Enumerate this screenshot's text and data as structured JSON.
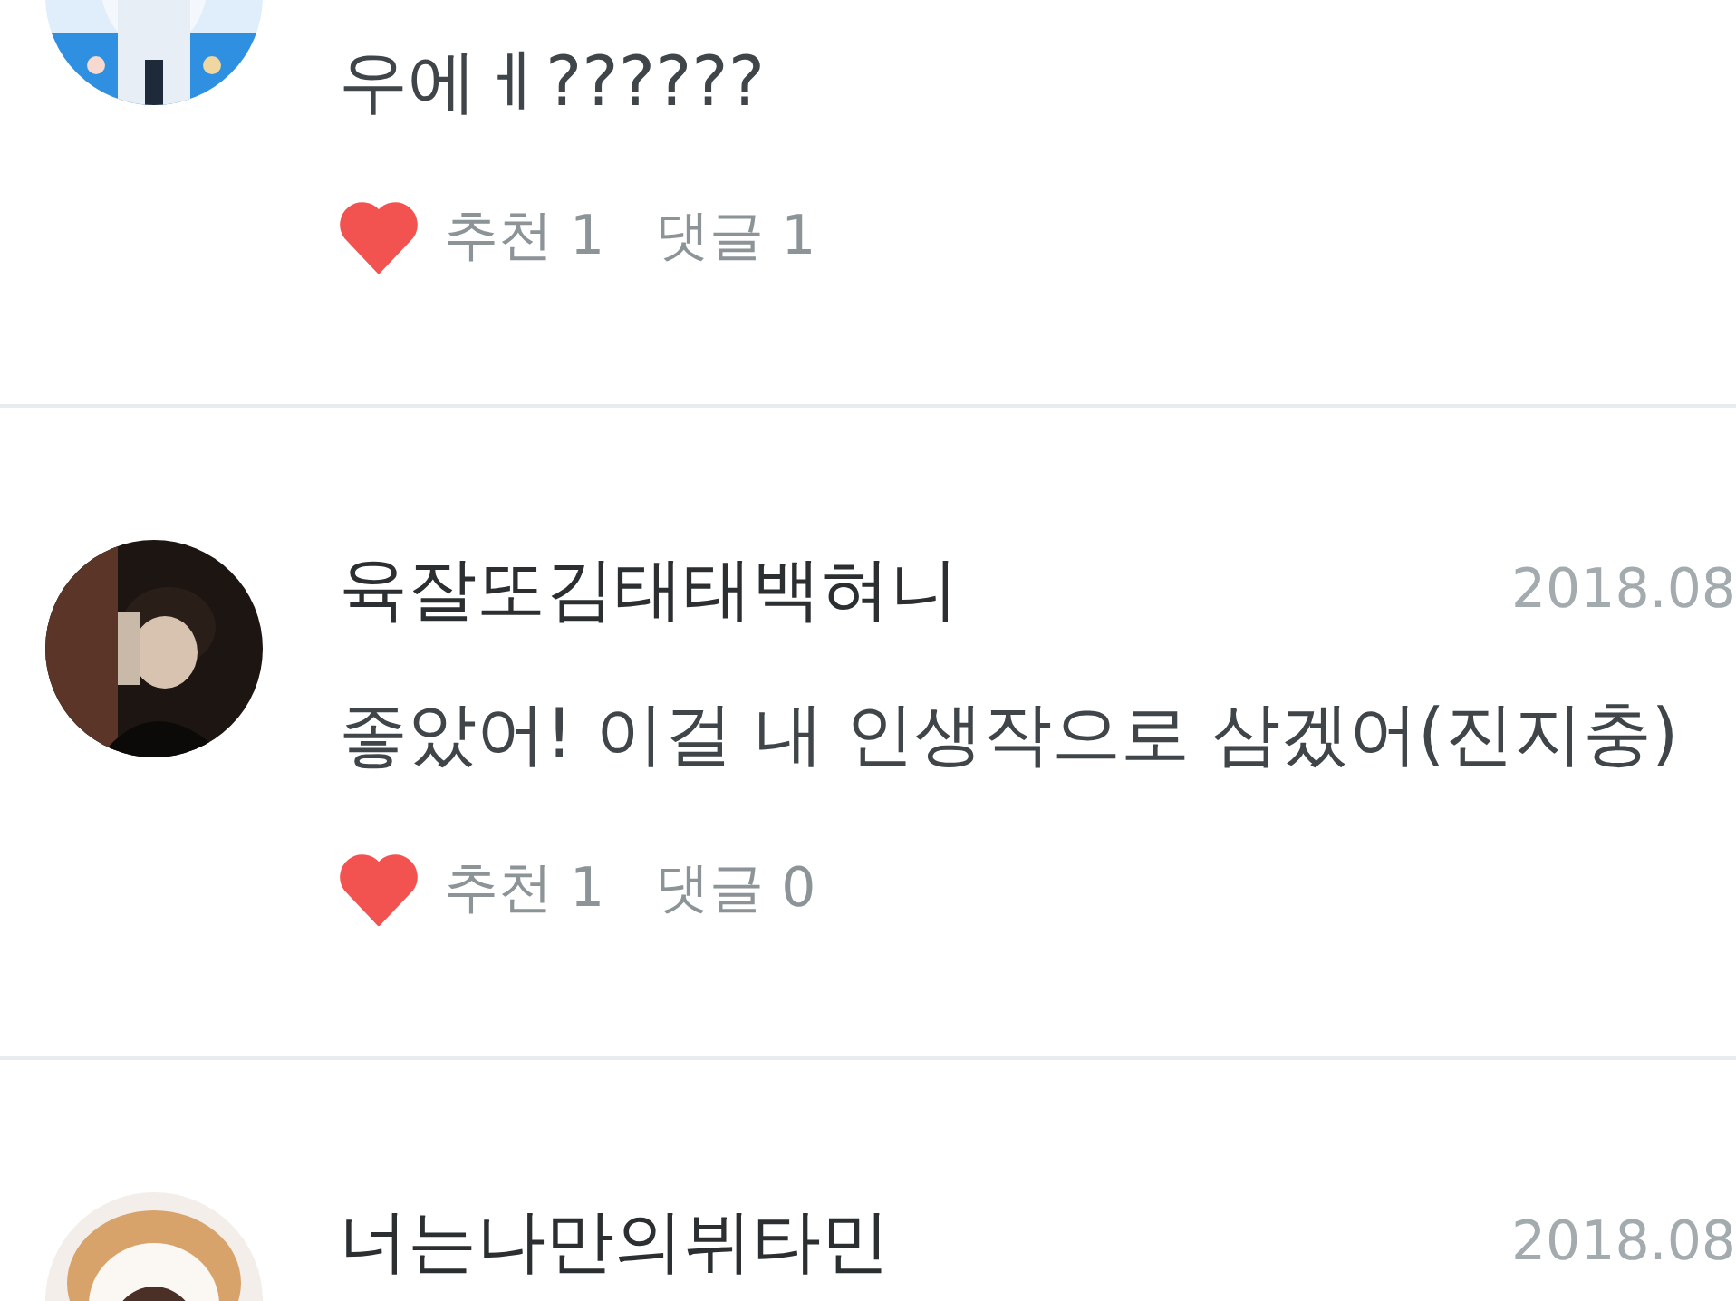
{
  "comments": [
    {
      "text": "우에ㅔ??????",
      "likes_label": "추천 1",
      "replies_label": "댓글 1",
      "liked": true
    },
    {
      "author": "육잘또김태태백혀니",
      "date": "2018.08",
      "text": "좋았어! 이걸 내 인생작으로 삼겠어(진지충)",
      "likes_label": "추천 1",
      "replies_label": "댓글 0",
      "liked": true
    },
    {
      "author": "너는나만의뷔타민",
      "date": "2018.08"
    }
  ]
}
